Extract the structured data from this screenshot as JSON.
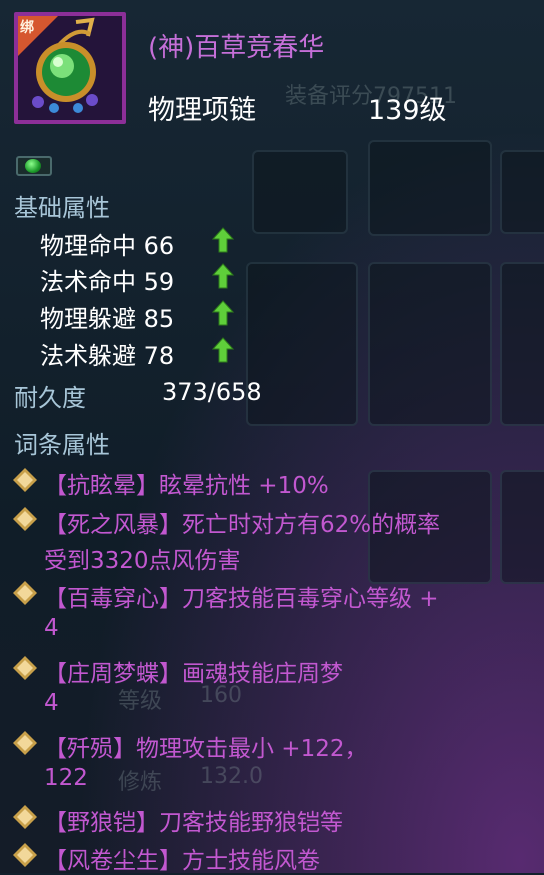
{
  "item": {
    "bind_label": "绑",
    "name": "(神)百草竞春华",
    "type": "物理项链",
    "level": "139级"
  },
  "background": {
    "eval_title": "装备评分797511",
    "level_label": "等级",
    "level_value": "160",
    "cultivate_label": "修炼",
    "cultivate_value": "132.0"
  },
  "base_attributes": {
    "heading": "基础属性",
    "rows": [
      {
        "text": "物理命中 66",
        "arrow": "up-arrow-icon"
      },
      {
        "text": "法术命中 59",
        "arrow": "up-arrow-icon"
      },
      {
        "text": "物理躲避 85",
        "arrow": "up-arrow-icon"
      },
      {
        "text": "法术躲避 78",
        "arrow": "up-arrow-icon"
      }
    ]
  },
  "durability": {
    "label": "耐久度",
    "value": "373/658"
  },
  "affix_heading": "词条属性",
  "affixes": [
    {
      "line1": "【抗眩晕】眩晕抗性 +10%"
    },
    {
      "line1": "【死之风暴】死亡时对方有62%的概率",
      "line2": "受到3320点风伤害"
    },
    {
      "line1": "【百毒穿心】刀客技能百毒穿心等级 +",
      "line2": "4"
    },
    {
      "line1": "【庄周梦蝶】画魂技能庄周梦",
      "line2": "4"
    },
    {
      "line1": "【歼殒】物理攻击最小 +122，",
      "line2": "122"
    },
    {
      "line1": "【野狼铠】刀客技能野狼铠等"
    },
    {
      "line1": "【风卷尘生】方士技能风卷"
    }
  ],
  "colors": {
    "title": "#c56fd8",
    "affix": "#c258d0",
    "heading": "#a8c6d8",
    "frame": "#8c2f98",
    "arrow": "#5fcf3a"
  }
}
